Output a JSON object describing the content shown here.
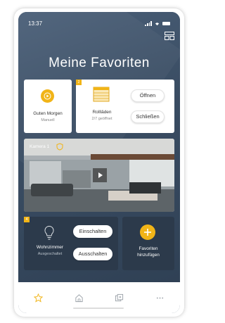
{
  "status_bar": {
    "time": "13:37"
  },
  "header": {
    "title": "Meine Favoriten",
    "layout_icon": "grid-layout-icon"
  },
  "cards": {
    "scene": {
      "label": "Guten Morgen",
      "sub": "Manuell",
      "icon": "play-icon"
    },
    "blinds": {
      "badge": "2",
      "label": "Rollläden",
      "sub": "2/7 geöffnet",
      "open_label": "Öffnen",
      "close_label": "Schließen",
      "icon": "blinds-icon"
    },
    "camera": {
      "label": "Kamera 1",
      "icon": "shield-icon"
    },
    "light": {
      "badge": "4",
      "label": "Wohnzimmer",
      "sub": "Ausgeschaltet",
      "on_label": "Einschalten",
      "off_label": "Ausschalten",
      "icon": "bulb-icon"
    },
    "add": {
      "label_line1": "Favoriten",
      "label_line2": "hinzufügen",
      "icon": "plus-icon"
    }
  },
  "tabbar": {
    "items": [
      "star-icon",
      "home-icon",
      "devices-icon",
      "more-icon"
    ],
    "active": "star-icon"
  },
  "colors": {
    "accent": "#f1b417",
    "background": "#3d5168",
    "card_dark": "#2c3a4b"
  }
}
